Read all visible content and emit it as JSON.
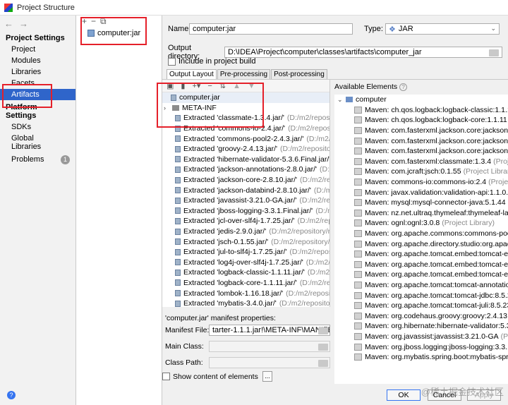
{
  "window": {
    "title": "Project Structure"
  },
  "nav": {
    "project_settings_label": "Project Settings",
    "project_items": [
      "Project",
      "Modules",
      "Libraries",
      "Facets",
      "Artifacts"
    ],
    "selected": "Artifacts",
    "platform_settings_label": "Platform Settings",
    "platform_items": [
      "SDKs",
      "Global Libraries"
    ],
    "problems_label": "Problems",
    "problems_count": "1"
  },
  "artifacts": {
    "items": [
      "computer:jar"
    ]
  },
  "form": {
    "name_label": "Name:",
    "name_value": "computer:jar",
    "type_label": "Type:",
    "type_value": "JAR",
    "output_dir_label": "Output directory:",
    "output_dir_value": "D:\\IDEA\\Project\\computer\\classes\\artifacts\\computer_jar",
    "include_label": "Include in project build"
  },
  "tabs": [
    "Output Layout",
    "Pre-processing",
    "Post-processing"
  ],
  "layout_tree": {
    "root": "computer.jar",
    "meta_inf": "META-INF",
    "extracted": [
      {
        "label": "Extracted 'classmate-1.3.4.jar/'",
        "path": "(D:/m2/repository/co"
      },
      {
        "label": "Extracted 'commons-io-2.4.jar/'",
        "path": "(D:/m2/repository/co"
      },
      {
        "label": "Extracted 'commons-pool2-2.4.3.jar/'",
        "path": "(D:/m2/reposito"
      },
      {
        "label": "Extracted 'groovy-2.4.13.jar/'",
        "path": "(D:/m2/repository/org/"
      },
      {
        "label": "Extracted 'hibernate-validator-5.3.6.Final.jar/'",
        "path": "(D:/m2/re"
      },
      {
        "label": "Extracted 'jackson-annotations-2.8.0.jar/'",
        "path": "(D:/m2/repos"
      },
      {
        "label": "Extracted 'jackson-core-2.8.10.jar/'",
        "path": "(D:/m2/repositor"
      },
      {
        "label": "Extracted 'jackson-databind-2.8.10.jar/'",
        "path": "(D:/m2/repos"
      },
      {
        "label": "Extracted 'javassist-3.21.0-GA.jar/'",
        "path": "(D:/m2/repository/"
      },
      {
        "label": "Extracted 'jboss-logging-3.3.1.Final.jar/'",
        "path": "(D:/m2/repo"
      },
      {
        "label": "Extracted 'jcl-over-slf4j-1.7.25.jar/'",
        "path": "(D:/m2/reposito"
      },
      {
        "label": "Extracted 'jedis-2.9.0.jar/'",
        "path": "(D:/m2/repository/redis/cl"
      },
      {
        "label": "Extracted 'jsch-0.1.55.jar/'",
        "path": "(D:/m2/repository/com/jc"
      },
      {
        "label": "Extracted 'jul-to-slf4j-1.7.25.jar/'",
        "path": "(D:/m2/repository/"
      },
      {
        "label": "Extracted 'log4j-over-slf4j-1.7.25.jar/'",
        "path": "(D:/m2/reposit"
      },
      {
        "label": "Extracted 'logback-classic-1.1.11.jar/'",
        "path": "(D:/m2/reposit"
      },
      {
        "label": "Extracted 'logback-core-1.1.11.jar/'",
        "path": "(D:/m2/repositor"
      },
      {
        "label": "Extracted 'lombok-1.16.18.jar/'",
        "path": "(D:/m2/repository/or"
      },
      {
        "label": "Extracted 'mybatis-3.4.0.jar/'",
        "path": "(D:/m2/repository/org/"
      }
    ]
  },
  "available": {
    "label": "Available Elements",
    "root": "computer",
    "items": [
      {
        "label": "Maven: ch.qos.logback:logback-classic:1.1.11",
        "meta": "(Pro"
      },
      {
        "label": "Maven: ch.qos.logback:logback-core:1.1.11",
        "meta": "(Proj"
      },
      {
        "label": "Maven: com.fasterxml.jackson.core:jackson-annot",
        "meta": ""
      },
      {
        "label": "Maven: com.fasterxml.jackson.core:jackson-core:2",
        "meta": ""
      },
      {
        "label": "Maven: com.fasterxml.jackson.core:jackson-datab",
        "meta": ""
      },
      {
        "label": "Maven: com.fasterxml:classmate:1.3.4",
        "meta": "(Project Lib"
      },
      {
        "label": "Maven: com.jcraft:jsch:0.1.55",
        "meta": "(Project Library)"
      },
      {
        "label": "Maven: commons-io:commons-io:2.4",
        "meta": "(Project Libr"
      },
      {
        "label": "Maven: javax.validation:validation-api:1.1.0.Final",
        "meta": "(Pro"
      },
      {
        "label": "Maven: mysql:mysql-connector-java:5.1.44",
        "meta": "(Projec"
      },
      {
        "label": "Maven: nz.net.ultraq.thymeleaf:thymeleaf-layout-c",
        "meta": ""
      },
      {
        "label": "Maven: ognl:ognl:3.0.8",
        "meta": "(Project Library)"
      },
      {
        "label": "Maven: org.apache.commons:commons-pool2:2.4",
        "meta": ""
      },
      {
        "label": "Maven: org.apache.directory.studio:org.apache.co",
        "meta": ""
      },
      {
        "label": "Maven: org.apache.tomcat.embed:tomcat-embed",
        "meta": ""
      },
      {
        "label": "Maven: org.apache.tomcat.embed:tomcat-embed",
        "meta": ""
      },
      {
        "label": "Maven: org.apache.tomcat.embed:tomcat-embed",
        "meta": ""
      },
      {
        "label": "Maven: org.apache.tomcat:tomcat-annotations-ap",
        "meta": ""
      },
      {
        "label": "Maven: org.apache.tomcat:tomcat-jdbc:8.5.23",
        "meta": "(Pro"
      },
      {
        "label": "Maven: org.apache.tomcat:tomcat-juli:8.5.23",
        "meta": "(Proj"
      },
      {
        "label": "Maven: org.codehaus.groovy:groovy:2.4.13",
        "meta": "(Proje"
      },
      {
        "label": "Maven: org.hibernate:hibernate-validator:5.3.6.Fin",
        "meta": ""
      },
      {
        "label": "Maven: org.javassist:javassist:3.21.0-GA",
        "meta": "(Project L"
      },
      {
        "label": "Maven: org.jboss.logging:jboss-logging:3.3.1.Fina",
        "meta": ""
      },
      {
        "label": "Maven: org.mybatis.spring.boot:mybatis-spring-b",
        "meta": ""
      }
    ]
  },
  "manifest": {
    "title": "'computer.jar' manifest properties:",
    "file_label": "Manifest File:",
    "file_value": "tarter-1.1.1.jar!\\META-INF\\MANIFEST.MF",
    "main_class_label": "Main Class:",
    "class_path_label": "Class Path:"
  },
  "show_content_label": "Show content of elements",
  "dots_label": "...",
  "buttons": {
    "ok": "OK",
    "cancel": "Cancel",
    "apply": "Apply"
  },
  "watermark": "@稀土掘金技术社区"
}
